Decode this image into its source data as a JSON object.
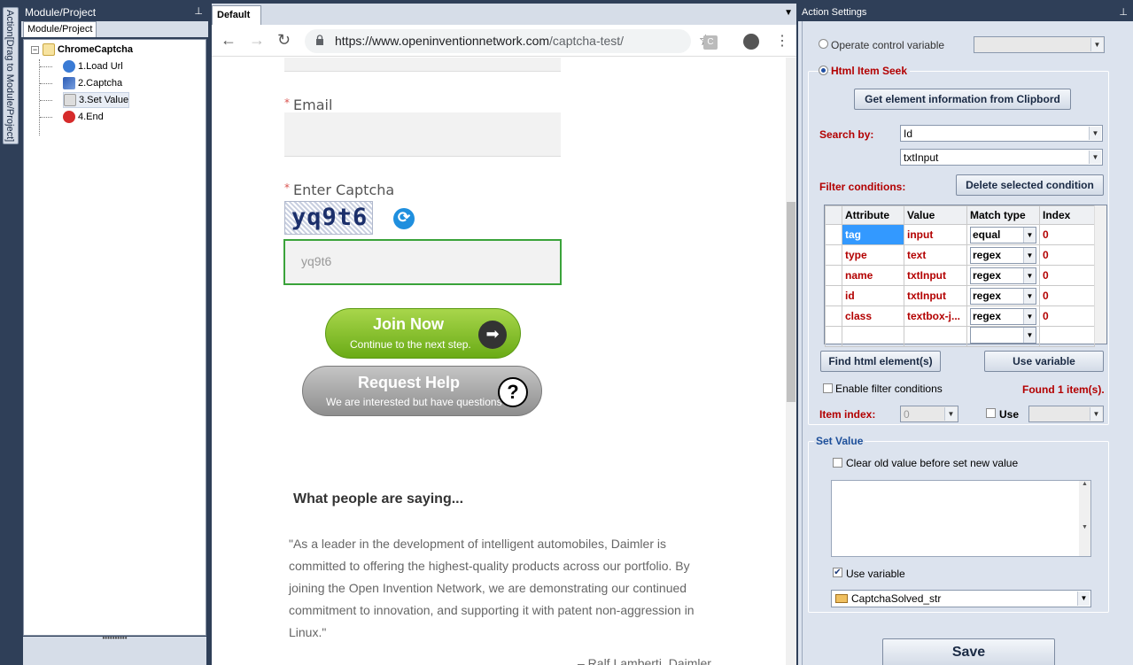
{
  "left_strip": {
    "tab_label": "Action[Drag to Module/Project]"
  },
  "module_panel": {
    "title": "Module/Project",
    "tab": "Module/Project",
    "tree": {
      "root": "ChromeCaptcha",
      "items": [
        "1.Load Url",
        "2.Captcha",
        "3.Set Value",
        "4.End"
      ]
    }
  },
  "browser": {
    "doc_tab": "Default",
    "url_host": "https://www.openinventionnetwork.com",
    "url_path": "/captcha-test/",
    "page": {
      "email_label": "Email",
      "captcha_label": "Enter Captcha",
      "captcha_text": "yq9t6",
      "captcha_input_value": "yq9t6",
      "join_title": "Join Now",
      "join_sub": "Continue to the next step.",
      "help_title": "Request Help",
      "help_sub": "We are interested but have questions",
      "saying_heading": "What people are saying...",
      "quote": "\"As a leader in the development of intelligent automobiles, Daimler is committed to offering the highest-quality products across our portfolio. By joining the Open Invention Network, we are demonstrating our continued commitment to innovation, and supporting it with patent non-aggression in Linux.\"",
      "quote_author": "– Ralf Lamberti, Daimler"
    }
  },
  "settings": {
    "title": "Action Settings",
    "operate_control_variable": "Operate control variable",
    "html_item_seek": "Html Item Seek",
    "get_element_button": "Get element information from Clipbord",
    "search_by_label": "Search by:",
    "search_by_value": "Id",
    "search_value": "txtInput",
    "filter_label": "Filter conditions:",
    "delete_condition_button": "Delete selected condition",
    "grid": {
      "columns": [
        "Attribute",
        "Value",
        "Match type",
        "Index"
      ],
      "rows": [
        {
          "attribute": "tag",
          "value": "input",
          "match": "equal",
          "index": "0"
        },
        {
          "attribute": "type",
          "value": "text",
          "match": "regex",
          "index": "0"
        },
        {
          "attribute": "name",
          "value": "txtInput",
          "match": "regex",
          "index": "0"
        },
        {
          "attribute": "id",
          "value": "txtInput",
          "match": "regex",
          "index": "0"
        },
        {
          "attribute": "class",
          "value": "textbox-j...",
          "match": "regex",
          "index": "0"
        }
      ]
    },
    "find_button": "Find html element(s)",
    "use_variable_button": "Use variable",
    "enable_filter": "Enable filter conditions",
    "found_text": "Found 1 item(s).",
    "item_index_label": "Item index:",
    "item_index_value": "0",
    "use_label": "Use",
    "set_value_group": "Set Value",
    "clear_old_value": "Clear old value before set new value",
    "use_variable_check": "Use variable",
    "variable_name": "CaptchaSolved_str",
    "save_button": "Save"
  }
}
